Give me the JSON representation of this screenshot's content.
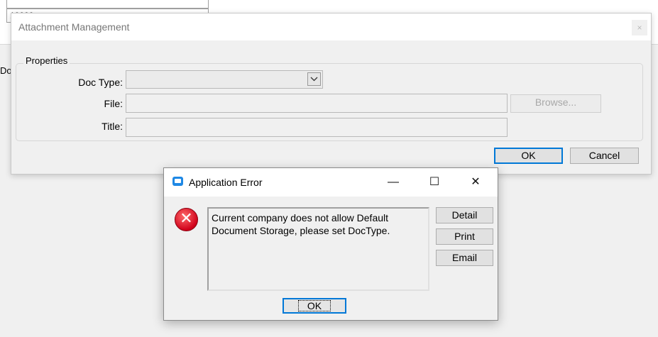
{
  "background": {
    "field_top_value": "",
    "field_second_value": "10000",
    "side_label": "Do"
  },
  "attachment_dialog": {
    "title": "Attachment Management",
    "close_label": "×",
    "group_label": "Properties",
    "doc_type_label": "Doc Type:",
    "doc_type_value": "",
    "file_label": "File:",
    "file_value": "",
    "title_label": "Title:",
    "title_value": "",
    "browse_label": "Browse...",
    "ok_label": "OK",
    "cancel_label": "Cancel"
  },
  "error_dialog": {
    "title": "Application Error",
    "minimize": "—",
    "maximize": "☐",
    "close": "✕",
    "error_glyph": "✕",
    "message": "Current company does not allow Default Document Storage, please set DocType.",
    "detail_label": "Detail",
    "print_label": "Print",
    "email_label": "Email",
    "ok_label": "OK"
  }
}
